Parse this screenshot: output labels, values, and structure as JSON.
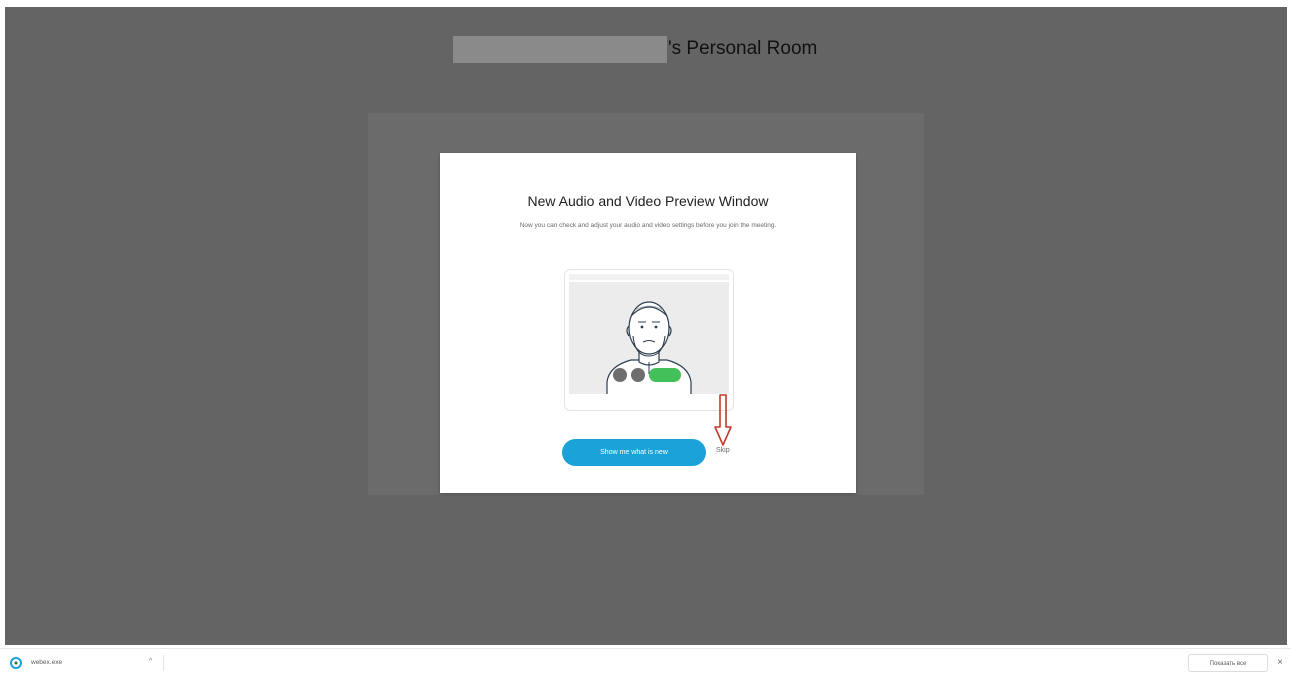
{
  "header": {
    "room_title": "'s Personal Room"
  },
  "modal": {
    "title": "New Audio and Video Preview Window",
    "description": "Now you can check and adjust your audio and video settings before you join the meeting.",
    "primary_button_label": "Show me what is new",
    "skip_label": "Skip"
  },
  "colors": {
    "backdrop": "#646464",
    "primary_button": "#1aa2d9",
    "annotation_arrow": "#c0392b",
    "video_toggle": "#44c05a"
  },
  "download_bar": {
    "file_name": "webex.exe",
    "caret": "^",
    "show_all_label": "Показать все",
    "close_label": "×",
    "file_icon": "webex-installer-icon"
  }
}
